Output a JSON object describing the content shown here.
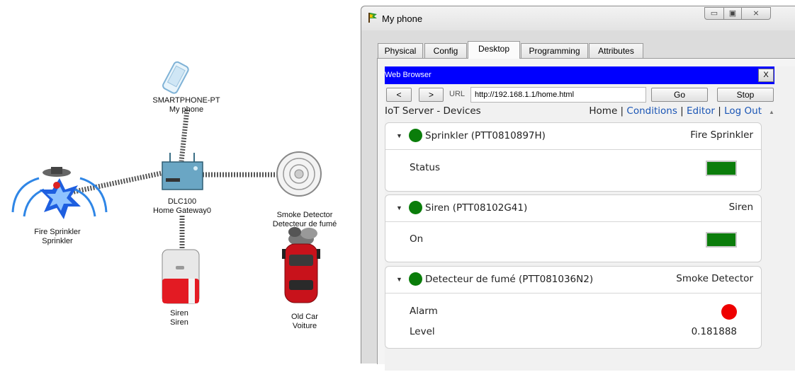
{
  "topology": {
    "devices": [
      {
        "id": "smartphone",
        "line1": "SMARTPHONE-PT",
        "line2": "My phone"
      },
      {
        "id": "gateway",
        "line1": "DLC100",
        "line2": "Home Gateway0"
      },
      {
        "id": "sprinkler",
        "line1": "Fire Sprinkler",
        "line2": "Sprinkler"
      },
      {
        "id": "smoke",
        "line1": "Smoke Detector",
        "line2": "Detecteur de fumé"
      },
      {
        "id": "siren",
        "line1": "Siren",
        "line2": "Siren"
      },
      {
        "id": "car",
        "line1": "Old Car",
        "line2": "Voiture"
      }
    ]
  },
  "window": {
    "title": "My phone",
    "controls": {
      "minimize": "▭",
      "maximize": "▣",
      "close": "⨯"
    },
    "tabs": [
      {
        "label": "Physical"
      },
      {
        "label": "Config"
      },
      {
        "label": "Desktop",
        "active": true
      },
      {
        "label": "Programming"
      },
      {
        "label": "Attributes"
      }
    ]
  },
  "browser": {
    "title": "Web Browser",
    "close_label": "X",
    "back_label": "<",
    "forward_label": ">",
    "url_label": "URL",
    "url": "http://192.168.1.1/home.html",
    "go_label": "Go",
    "stop_label": "Stop"
  },
  "iot_page": {
    "heading": "IoT Server - Devices",
    "nav": {
      "home": "Home",
      "conditions": "Conditions",
      "editor": "Editor",
      "logout": "Log Out",
      "separator": " | "
    },
    "devices": [
      {
        "name": "Sprinkler (PTT0810897H)",
        "type": "Fire Sprinkler",
        "status_color": "#0a7d0a",
        "properties": [
          {
            "label": "Status",
            "indicator": "green-toggle",
            "value": "on"
          }
        ]
      },
      {
        "name": "Siren (PTT08102G41)",
        "type": "Siren",
        "status_color": "#0a7d0a",
        "properties": [
          {
            "label": "On",
            "indicator": "green-toggle",
            "value": "on"
          }
        ]
      },
      {
        "name": "Detecteur de fumé (PTT081036N2)",
        "type": "Smoke Detector",
        "status_color": "#0a7d0a",
        "properties": [
          {
            "label": "Alarm",
            "indicator": "red-dot",
            "value": "on"
          },
          {
            "label": "Level",
            "value": "0.181888"
          }
        ]
      }
    ]
  },
  "colors": {
    "browser_bar": "#0000ff",
    "status_green": "#0a7d0a",
    "alarm_red": "#ee0000",
    "link": "#1a55b5"
  }
}
